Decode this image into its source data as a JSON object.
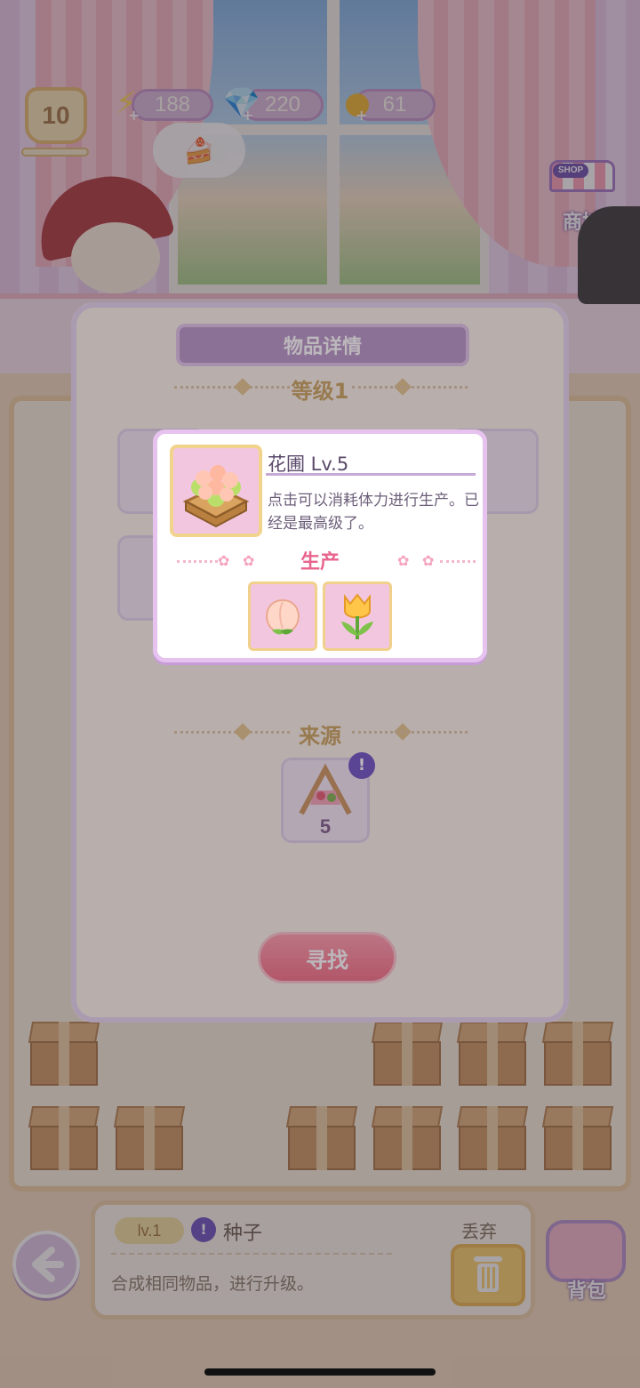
{
  "hud": {
    "level": "10",
    "energy": "188",
    "gems": "220",
    "coins": "61",
    "shop_sign": "SHOP",
    "shop_label": "商城"
  },
  "detail_panel": {
    "title": "物品详情",
    "level_section": "等级1",
    "source_section": "来源",
    "source_item_count": "5",
    "find_button": "寻找"
  },
  "popup": {
    "name": "花圃  Lv.5",
    "description": "点击可以消耗体力进行生产。已经是最高级了。",
    "produce_title": "生产",
    "products": [
      {
        "icon": "peach-icon",
        "glyph": "🍑"
      },
      {
        "icon": "tulip-icon",
        "glyph": "🌷"
      }
    ],
    "item_icon_glyph": "🌸"
  },
  "info_bar": {
    "level_badge": "lv.1",
    "item_name": "种子",
    "description": "合成相同物品，进行升级。",
    "discard_label": "丢弃"
  },
  "bag": {
    "label": "背包"
  },
  "colors": {
    "accent_pink": "#f26b82",
    "panel_border": "#e6c3ef",
    "produce_title": "#e8658d",
    "section_title": "#c9a15a"
  }
}
